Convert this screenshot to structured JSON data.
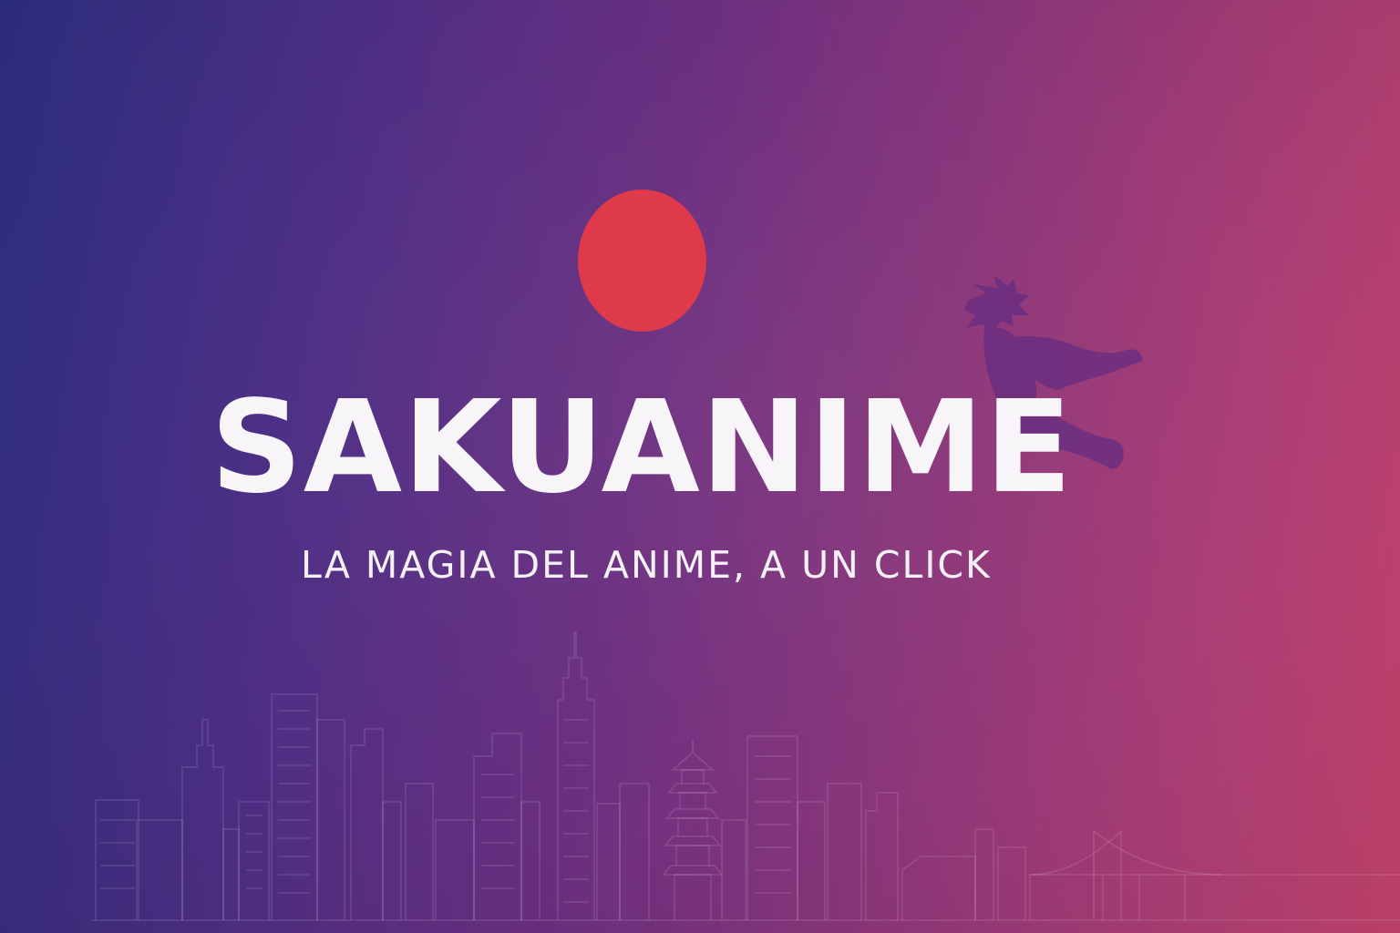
{
  "brand": {
    "title": "SAKUANIME",
    "tagline": "LA MAGIA DEL ANIME, A UN CLICK"
  },
  "colors": {
    "sun": "#de3a4a",
    "gradient_left": "#2e2f82",
    "gradient_right": "#c8446f",
    "text": "#f7f5f8"
  },
  "decorations": {
    "sun_icon": "red-sun-circle",
    "figure_icon": "flying-hero-silhouette",
    "skyline_icon": "city-skyline-outline"
  }
}
